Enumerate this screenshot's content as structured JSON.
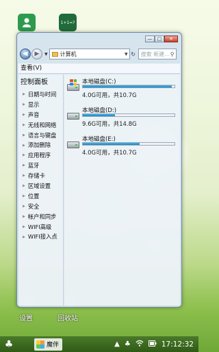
{
  "desktop": {
    "labels": [
      "设置",
      "回收站"
    ]
  },
  "window": {
    "address": "计算机",
    "search_placeholder": "搜索 新建…",
    "menu": "查看(V)",
    "controls": [
      "minimize-icon",
      "maximize-icon",
      "close-icon"
    ]
  },
  "left_panel": {
    "title": "控制面板",
    "items": [
      "日期与时间",
      "显示",
      "声音",
      "无线和网络",
      "语言与键盘",
      "添加删除",
      "应用程序",
      "蓝牙",
      "存储卡",
      "区域设置",
      "位置",
      "安全",
      "帐户和同步",
      "WIFI高级",
      "WIFI接入点"
    ]
  },
  "drives": [
    {
      "name": "本地磁盘(C:)",
      "info": "4.0G可用，共10.7G",
      "used_fraction": 0.97
    },
    {
      "name": "本地磁盘(D:)",
      "info": "9.6G可用，共14.8G",
      "used_fraction": 0.35
    },
    {
      "name": "本地磁盘(E:)",
      "info": "4.0G可用，共10.7G",
      "used_fraction": 0.62
    }
  ],
  "taskbar": {
    "app_label": "魔伴",
    "time": "17:12:32",
    "tray_icons": [
      "clover-icon",
      "up-arrow-icon",
      "clover-icon",
      "wifi-icon",
      "battery-icon"
    ]
  },
  "colors": {
    "bar_fill": "#1a84c3",
    "taskbar": "#3c6a20"
  }
}
